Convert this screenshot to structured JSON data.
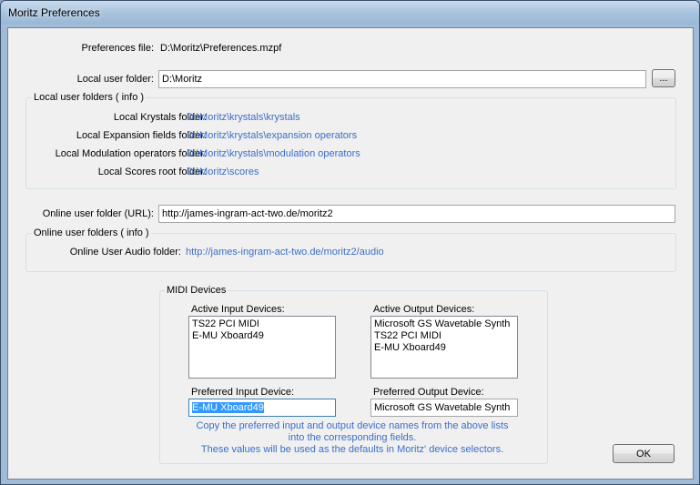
{
  "window": {
    "title": "Moritz Preferences"
  },
  "preferences_file": {
    "label": "Preferences file:",
    "value": "D:\\Moritz\\Preferences.mzpf"
  },
  "local_user_folder": {
    "label": "Local user folder:",
    "value": "D:\\Moritz",
    "browse_label": "..."
  },
  "local_group": {
    "title": "Local user folders ( info )",
    "rows": [
      {
        "label": "Local Krystals folder:",
        "value": "D:\\Moritz\\krystals\\krystals"
      },
      {
        "label": "Local Expansion fields folder:",
        "value": "D:\\Moritz\\krystals\\expansion operators"
      },
      {
        "label": "Local Modulation operators folder:",
        "value": "D:\\Moritz\\krystals\\modulation operators"
      },
      {
        "label": "Local Scores root folder:",
        "value": "D:\\Moritz\\scores"
      }
    ]
  },
  "online_user_folder": {
    "label": "Online user folder (URL):",
    "value": "http://james-ingram-act-two.de/moritz2"
  },
  "online_group": {
    "title": "Online user folders ( info )",
    "audio_label": "Online User Audio folder:",
    "audio_value": "http://james-ingram-act-two.de/moritz2/audio"
  },
  "midi": {
    "title": "MIDI Devices",
    "active_input_label": "Active Input Devices:",
    "active_inputs": [
      "TS22 PCI MIDI",
      "E-MU Xboard49"
    ],
    "active_output_label": "Active Output Devices:",
    "active_outputs": [
      "Microsoft GS Wavetable Synth",
      "TS22 PCI MIDI",
      "E-MU Xboard49"
    ],
    "preferred_input_label": "Preferred Input Device:",
    "preferred_input_value": "E-MU Xboard49",
    "preferred_output_label": "Preferred Output Device:",
    "preferred_output_value": "Microsoft GS Wavetable Synth",
    "note_line1": "Copy the preferred input and output device names from the above lists",
    "note_line2": "into the corresponding fields.",
    "note_line3": "These values will be used as the defaults in Moritz' device selectors."
  },
  "ok_label": "OK",
  "colors": {
    "link": "#3d6ec9",
    "selection": "#3399ff"
  }
}
